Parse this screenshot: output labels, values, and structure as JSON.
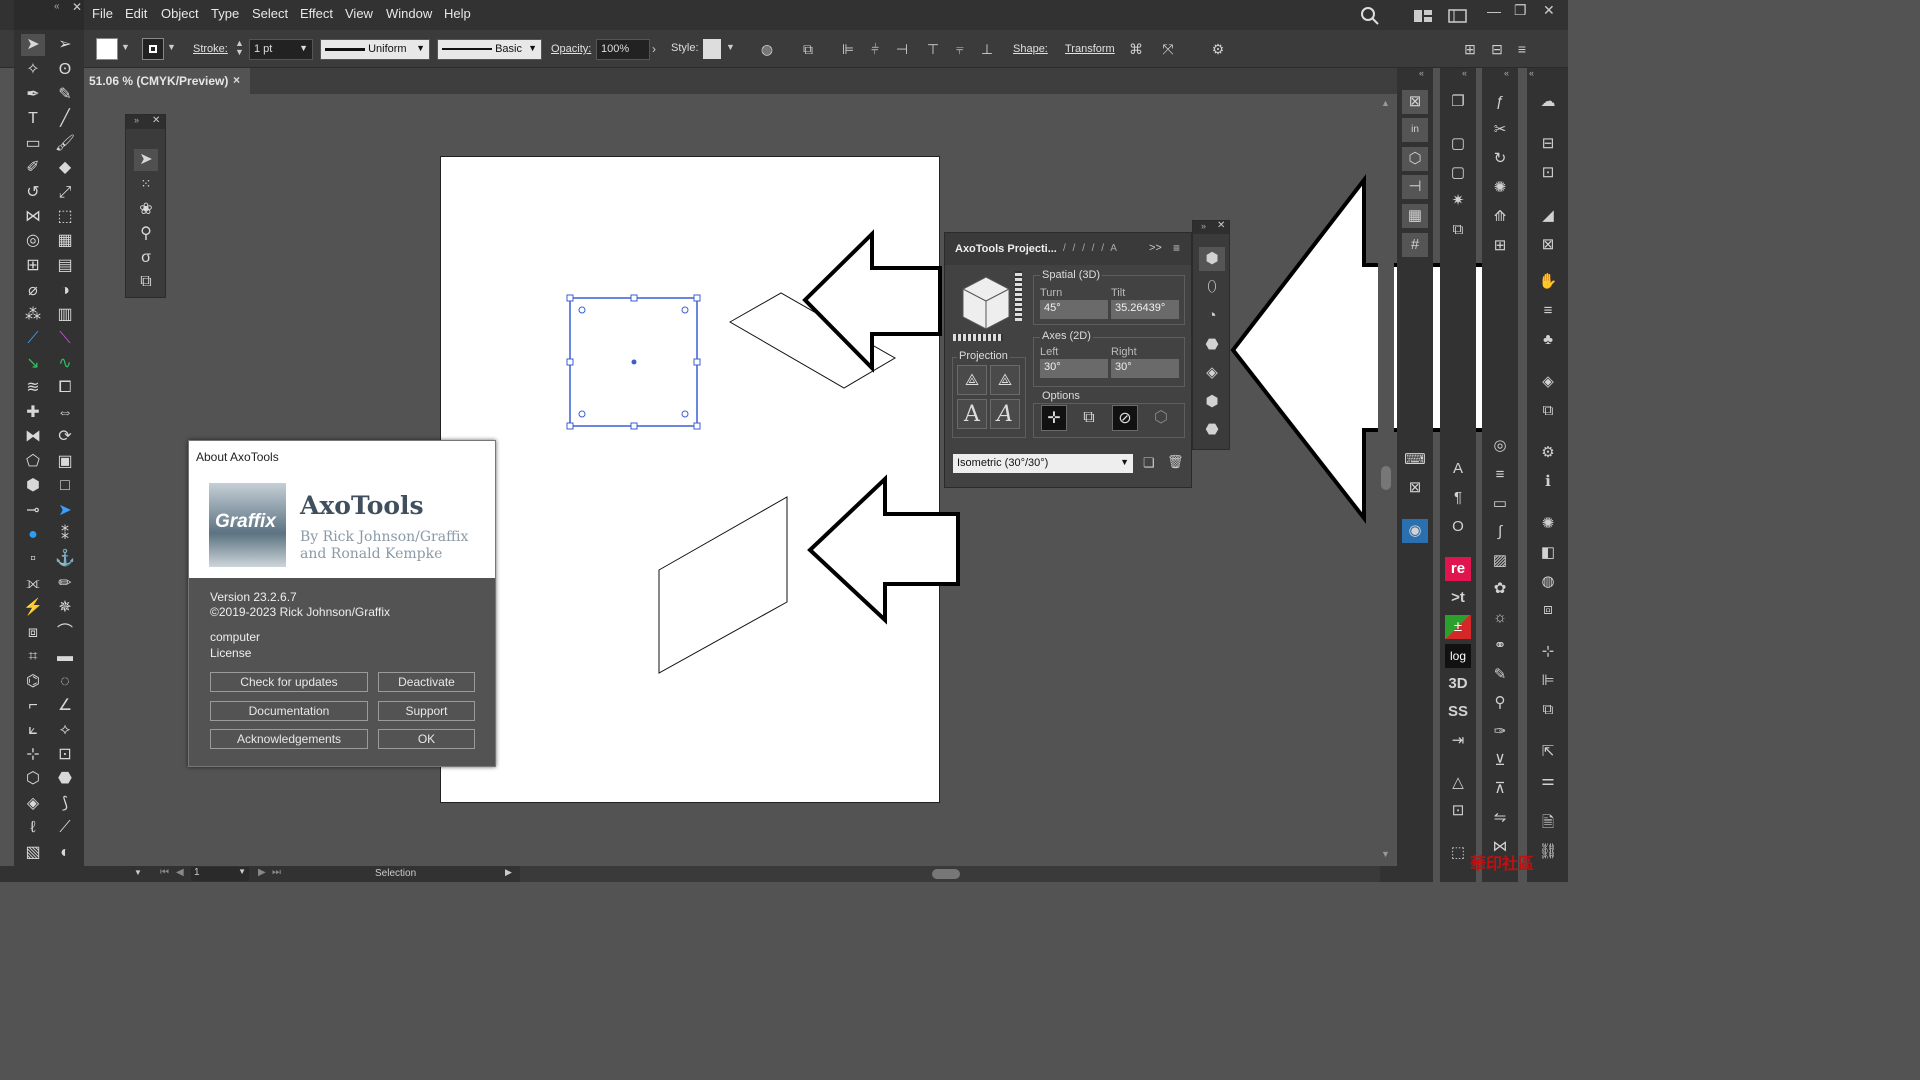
{
  "menu": [
    "File",
    "Edit",
    "Object",
    "Type",
    "Select",
    "Effect",
    "View",
    "Window",
    "Help"
  ],
  "control_bar": {
    "stroke_label": "Stroke:",
    "stroke_value": "1 pt",
    "profile_uniform": "Uniform",
    "brush_basic": "Basic",
    "opacity_label": "Opacity:",
    "opacity_value": "100%",
    "style_label": "Style:",
    "shape_label": "Shape:",
    "transform_label": "Transform"
  },
  "document_tab": {
    "title": "51.06 % (CMYK/Preview)",
    "close": "×"
  },
  "about_dialog": {
    "title": "About AxoTools",
    "logo_text": "Graffix",
    "product_name": "AxoTools",
    "author_line1": "By Rick Johnson/Graffix",
    "author_line2": "and Ronald Kempke",
    "version": "Version 23.2.6.7",
    "copyright": "©2019-2023 Rick Johnson/Graffix",
    "license_user": "computer",
    "license_label": "License",
    "buttons": {
      "check_updates": "Check for updates",
      "deactivate": "Deactivate",
      "documentation": "Documentation",
      "support": "Support",
      "acknowledgements": "Acknowledgements",
      "ok": "OK"
    }
  },
  "axo_panel": {
    "title": "AxoTools Projecti...",
    "tab_marks": "/ / / / / A",
    "more": ">>",
    "spatial_group": "Spatial (3D)",
    "turn_label": "Turn",
    "turn_value": "45°",
    "tilt_label": "Tilt",
    "tilt_value": "35.26439°",
    "axes_group": "Axes (2D)",
    "left_label": "Left",
    "left_value": "30°",
    "right_label": "Right",
    "right_value": "30°",
    "projection_group": "Projection",
    "options_group": "Options",
    "preset_value": "Isometric (30°/30°)"
  },
  "status_bar": {
    "zoom": "1",
    "tool": "Selection"
  },
  "right_panel_labels": {
    "re": "re",
    "xt": ">t",
    "log": "log",
    "three_d": "3D",
    "ss": "SS"
  },
  "watermark": "華印社區",
  "colors": {
    "selection_blue": "#3a5fd0",
    "accent_red": "#e0144e",
    "accent_blue": "#2a9df4"
  }
}
